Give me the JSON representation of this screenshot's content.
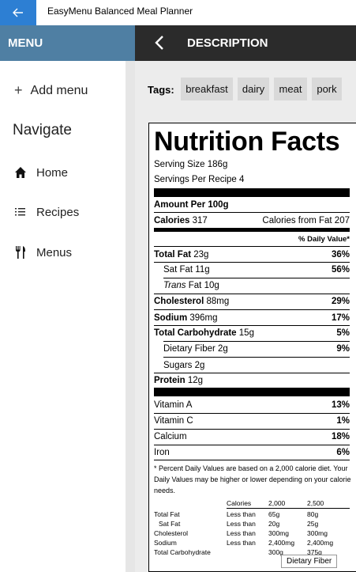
{
  "app": {
    "title": "EasyMenu Balanced Meal Planner"
  },
  "header": {
    "menu_label": "MENU",
    "description_label": "DESCRIPTION"
  },
  "sidebar": {
    "add_menu": "Add menu",
    "navigate": "Navigate",
    "items": [
      {
        "label": "Home",
        "icon": "home-icon"
      },
      {
        "label": "Recipes",
        "icon": "list-icon"
      },
      {
        "label": "Menus",
        "icon": "utensils-icon"
      }
    ]
  },
  "tags": {
    "label": "Tags:",
    "items": [
      "breakfast",
      "dairy",
      "meat",
      "pork"
    ]
  },
  "nutrition": {
    "title": "Nutrition Facts",
    "serving_size": "Serving Size 186g",
    "servings": "Servings Per Recipe 4",
    "amount_per": "Amount Per 100g",
    "calories_label": "Calories",
    "calories_value": "317",
    "calories_fat": "Calories from Fat 207",
    "daily_value_header": "% Daily Value*",
    "rows": [
      {
        "label": "Total Fat",
        "amount": "23g",
        "pct": "36%"
      },
      {
        "label": "Sat Fat",
        "amount": "11g",
        "pct": "56%"
      },
      {
        "label": "Trans",
        "label2": "Fat",
        "amount": "10g",
        "pct": ""
      },
      {
        "label": "Cholesterol",
        "amount": "88mg",
        "pct": "29%"
      },
      {
        "label": "Sodium",
        "amount": "396mg",
        "pct": "17%"
      },
      {
        "label": "Total Carbohydrate",
        "amount": "15g",
        "pct": "5%"
      },
      {
        "label": "Dietary Fiber",
        "amount": "2g",
        "pct": "9%"
      },
      {
        "label": "Sugars",
        "amount": "2g",
        "pct": ""
      },
      {
        "label": "Protein",
        "amount": "12g",
        "pct": ""
      }
    ],
    "vitamins": [
      {
        "label": "Vitamin A",
        "pct": "13%"
      },
      {
        "label": "Vitamin C",
        "pct": "1%"
      },
      {
        "label": "Calcium",
        "pct": "18%"
      },
      {
        "label": "Iron",
        "pct": "6%"
      }
    ],
    "footnote": "* Percent Daily Values are based on a 2,000 calorie diet. Your Daily Values may be higher or lower depending on your calorie needs.",
    "table": {
      "headers": [
        "Calories",
        "2,000",
        "2,500"
      ],
      "rows": [
        [
          "Total Fat",
          "Less than",
          "65g",
          "80g"
        ],
        [
          "Sat Fat",
          "Less than",
          "20g",
          "25g"
        ],
        [
          "Cholesterol",
          "Less than",
          "300mg",
          "300mg"
        ],
        [
          "Sodium",
          "Less than",
          "2,400mg",
          "2,400mg"
        ],
        [
          "Total Carbohydrate",
          "",
          "300g",
          "375g"
        ]
      ]
    }
  },
  "tooltip": {
    "text": "Dietary Fiber"
  }
}
